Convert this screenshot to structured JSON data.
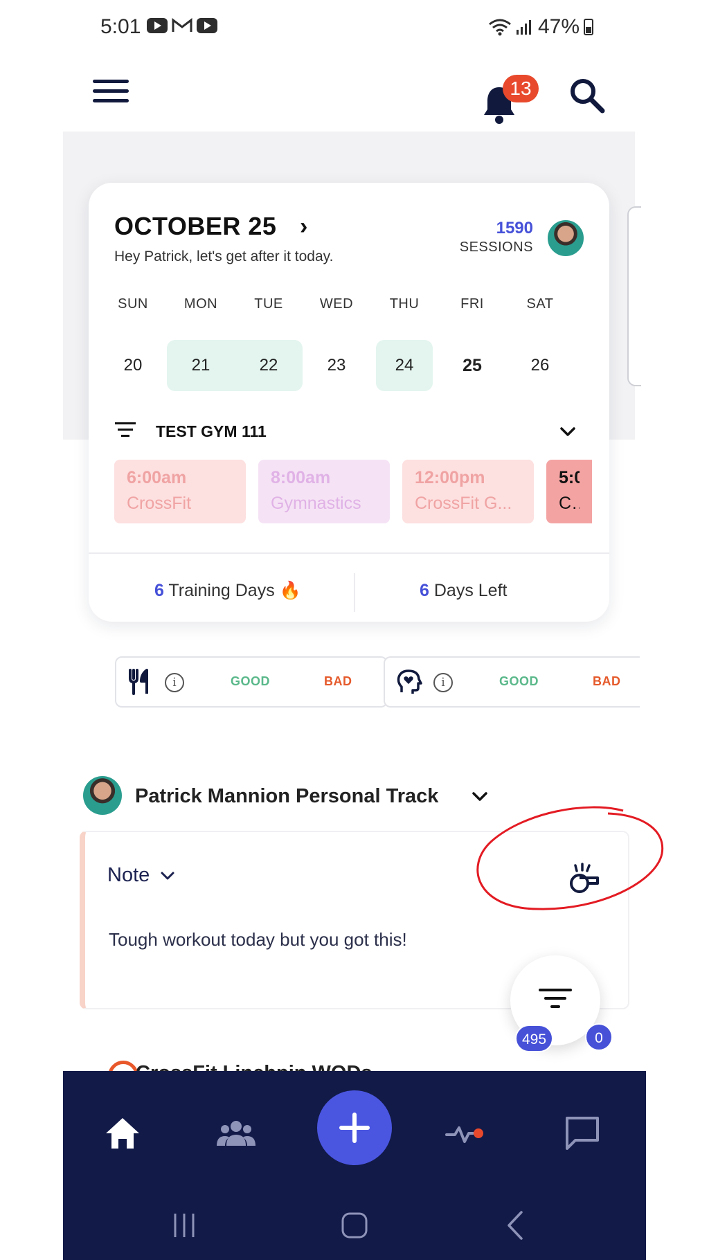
{
  "status_bar": {
    "time": "5:01",
    "battery": "47%"
  },
  "header": {
    "notification_count": "13"
  },
  "calendar": {
    "month_label": "OCTOBER 25",
    "greeting": "Hey Patrick, let's get after it today.",
    "sessions_count": "1590",
    "sessions_label": "SESSIONS",
    "days": [
      {
        "name": "SUN",
        "num": "20"
      },
      {
        "name": "MON",
        "num": "21"
      },
      {
        "name": "TUE",
        "num": "22"
      },
      {
        "name": "WED",
        "num": "23"
      },
      {
        "name": "THU",
        "num": "24"
      },
      {
        "name": "FRI",
        "num": "25"
      },
      {
        "name": "SAT",
        "num": "26"
      }
    ],
    "gym_name": "TEST GYM 111",
    "classes": [
      {
        "time": "6:00am",
        "name": "CrossFit"
      },
      {
        "time": "8:00am",
        "name": "Gymnastics"
      },
      {
        "time": "12:00pm",
        "name": "CrossFit G..."
      },
      {
        "time": "5:0",
        "name": "Cro"
      }
    ],
    "training_days_count": "6",
    "training_days_label": "Training Days 🔥",
    "days_left_count": "6",
    "days_left_label": "Days Left"
  },
  "trackers": {
    "good_label": "GOOD",
    "bad_label": "BAD"
  },
  "personal_track": {
    "title": "Patrick Mannion Personal Track",
    "note_label": "Note",
    "note_text": "Tough workout today but you got this!"
  },
  "next_track": {
    "title": "CrossFit Linchpin WODs",
    "count_badge": "495",
    "message_badge": "0"
  },
  "colors": {
    "accent": "#4651d8",
    "nav_bg": "#121a48",
    "good": "#5ab88a",
    "bad": "#e55a2b",
    "badge_red": "#e8492c"
  }
}
